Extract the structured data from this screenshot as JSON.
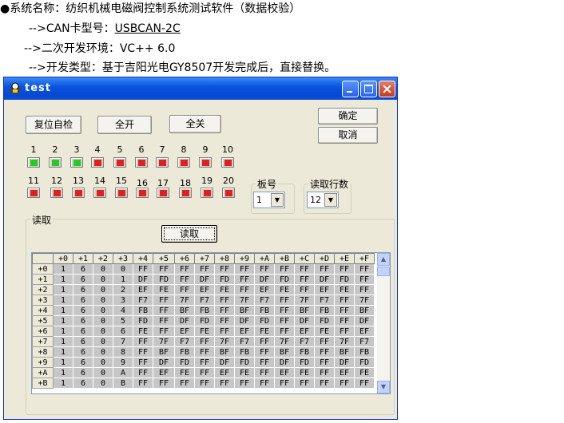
{
  "header": {
    "line1": "●系统名称：纺织机械电磁阀控制系统测试软件（数据校验）",
    "line2_prefix": "-->CAN卡型号：",
    "line2_link": "USBCAN-2C",
    "line3": "-->二次开发环境：VC++ 6.0",
    "line4": "-->开发类型：基于吉阳光电GY8507开发完成后，直接替换。"
  },
  "window": {
    "title": "test",
    "buttons": {
      "reset_check": "复位自检",
      "all_on": "全开",
      "all_off": "全关",
      "ok": "确定",
      "cancel": "取消",
      "read": "读取"
    },
    "leds": [
      {
        "label": "1",
        "state": "on"
      },
      {
        "label": "2",
        "state": "on"
      },
      {
        "label": "3",
        "state": "on"
      },
      {
        "label": "4",
        "state": "off"
      },
      {
        "label": "5",
        "state": "off"
      },
      {
        "label": "6",
        "state": "off"
      },
      {
        "label": "7",
        "state": "off"
      },
      {
        "label": "8",
        "state": "off"
      },
      {
        "label": "9",
        "state": "off"
      },
      {
        "label": "10",
        "state": "off"
      },
      {
        "label": "11",
        "state": "off"
      },
      {
        "label": "12",
        "state": "off"
      },
      {
        "label": "13",
        "state": "off"
      },
      {
        "label": "14",
        "state": "off"
      },
      {
        "label": "15",
        "state": "off"
      },
      {
        "label": "16",
        "state": "off"
      },
      {
        "label": "17",
        "state": "off"
      },
      {
        "label": "18",
        "state": "off"
      },
      {
        "label": "19",
        "state": "off"
      },
      {
        "label": "20",
        "state": "off"
      }
    ],
    "board_group": {
      "label": "板号",
      "value": "1"
    },
    "rows_group": {
      "label": "读取行数",
      "value": "12"
    },
    "read_group": {
      "label": "读取"
    },
    "grid": {
      "columns": [
        "",
        "+0",
        "+1",
        "+2",
        "+3",
        "+4",
        "+5",
        "+6",
        "+7",
        "+8",
        "+9",
        "+A",
        "+B",
        "+C",
        "+D",
        "+E",
        "+F"
      ],
      "rows": [
        [
          "+0",
          "1",
          "6",
          "0",
          "0",
          "FF",
          "FF",
          "FF",
          "FF",
          "FF",
          "FF",
          "FF",
          "FF",
          "FF",
          "FF",
          "FF",
          "FF"
        ],
        [
          "+1",
          "1",
          "6",
          "0",
          "1",
          "DF",
          "FD",
          "FF",
          "DF",
          "FD",
          "FF",
          "DF",
          "FD",
          "FF",
          "DF",
          "FD",
          "FF"
        ],
        [
          "+2",
          "1",
          "6",
          "0",
          "2",
          "EF",
          "FE",
          "FF",
          "EF",
          "FE",
          "FF",
          "EF",
          "FE",
          "FF",
          "EF",
          "FE",
          "FF"
        ],
        [
          "+3",
          "1",
          "6",
          "0",
          "3",
          "F7",
          "FF",
          "7F",
          "F7",
          "FF",
          "7F",
          "F7",
          "FF",
          "7F",
          "F7",
          "FF",
          "7F"
        ],
        [
          "+4",
          "1",
          "6",
          "0",
          "4",
          "FB",
          "FF",
          "BF",
          "FB",
          "FF",
          "BF",
          "FB",
          "FF",
          "BF",
          "FB",
          "FF",
          "BF"
        ],
        [
          "+5",
          "1",
          "6",
          "0",
          "5",
          "FD",
          "FF",
          "DF",
          "FD",
          "FF",
          "DF",
          "FD",
          "FF",
          "DF",
          "FD",
          "FF",
          "DF"
        ],
        [
          "+6",
          "1",
          "6",
          "0",
          "6",
          "FE",
          "FF",
          "EF",
          "FE",
          "FF",
          "EF",
          "FE",
          "FF",
          "EF",
          "FE",
          "FF",
          "EF"
        ],
        [
          "+7",
          "1",
          "6",
          "0",
          "7",
          "FF",
          "7F",
          "F7",
          "FF",
          "7F",
          "F7",
          "FF",
          "7F",
          "F7",
          "FF",
          "7F",
          "F7"
        ],
        [
          "+8",
          "1",
          "6",
          "0",
          "8",
          "FF",
          "BF",
          "FB",
          "FF",
          "BF",
          "FB",
          "FF",
          "BF",
          "FB",
          "FF",
          "BF",
          "FB"
        ],
        [
          "+9",
          "1",
          "6",
          "0",
          "9",
          "FF",
          "DF",
          "FD",
          "FF",
          "DF",
          "FD",
          "FF",
          "DF",
          "FD",
          "FF",
          "DF",
          "FD"
        ],
        [
          "+A",
          "1",
          "6",
          "0",
          "A",
          "FF",
          "EF",
          "FE",
          "FF",
          "EF",
          "FE",
          "FF",
          "EF",
          "FE",
          "FF",
          "EF",
          "FE"
        ],
        [
          "+B",
          "1",
          "6",
          "0",
          "B",
          "FF",
          "FF",
          "FF",
          "FF",
          "FF",
          "FF",
          "FF",
          "FF",
          "FF",
          "FF",
          "FF",
          "FF"
        ]
      ]
    }
  }
}
